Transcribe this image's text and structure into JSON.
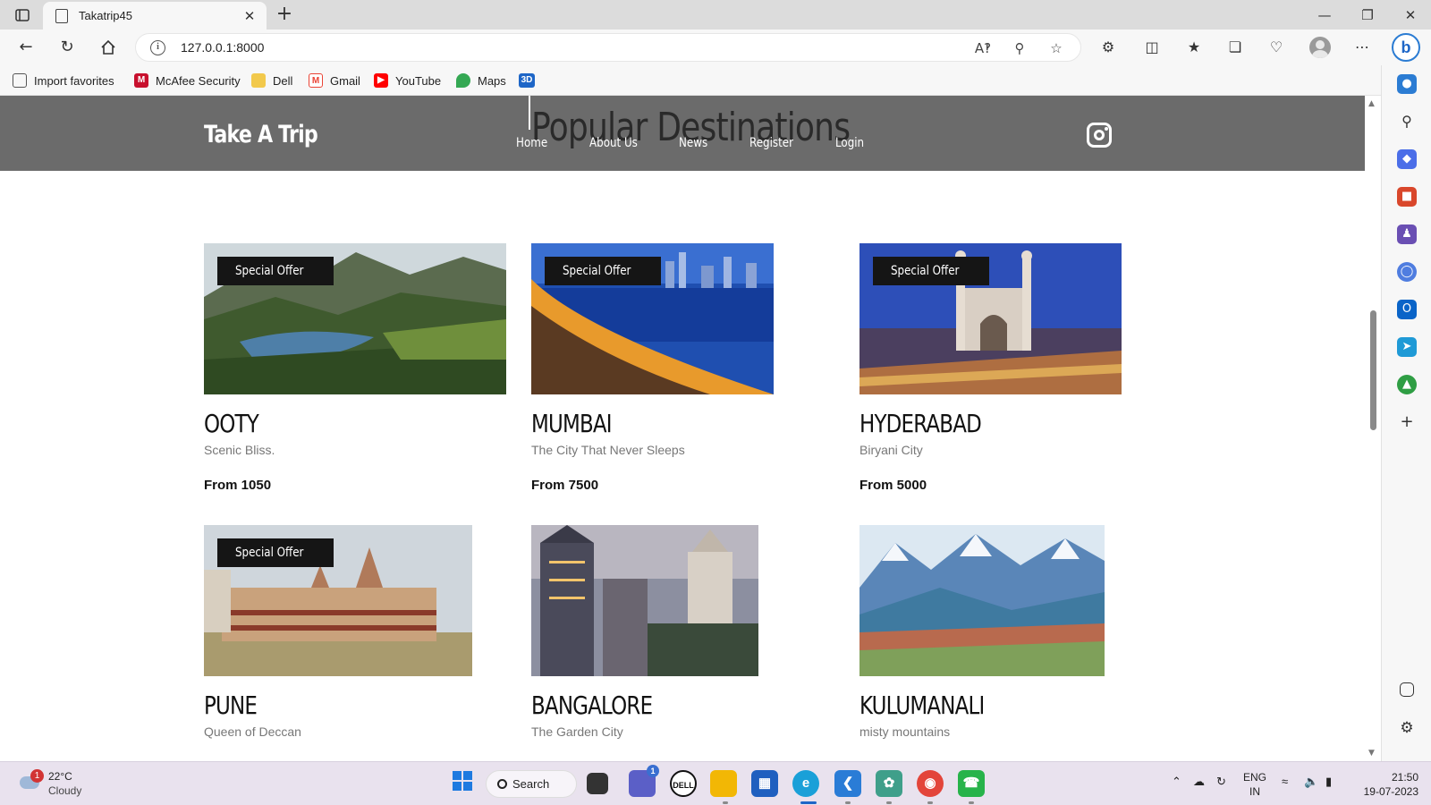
{
  "browser": {
    "tab_title": "Takatrip45",
    "tab_close": "✕",
    "new_tab": "+",
    "url": "127.0.0.1:8000",
    "window_controls": {
      "minimize": "—",
      "restore": "❐",
      "close": "✕"
    },
    "favorites": [
      {
        "label": "Import favorites",
        "icon": "import-icon",
        "color": "#555555"
      },
      {
        "label": "McAfee Security",
        "icon": "mcafee-icon",
        "color": "#c8102e"
      },
      {
        "label": "Dell",
        "icon": "folder-icon",
        "color": "#f2c94c"
      },
      {
        "label": "Gmail",
        "icon": "gmail-icon",
        "color": "#ea4335"
      },
      {
        "label": "YouTube",
        "icon": "youtube-icon",
        "color": "#ff0000"
      },
      {
        "label": "Maps",
        "icon": "maps-icon",
        "color": "#34a853"
      },
      {
        "label": "",
        "icon": "3d-icon",
        "color": "#1e66c7"
      }
    ]
  },
  "site": {
    "brand": "Take A Trip",
    "overlay_heading": "Popular Destinations",
    "nav": [
      "Home",
      "About Us",
      "News",
      "Register",
      "Login"
    ],
    "social_icon": "instagram-icon"
  },
  "destinations": [
    {
      "name": "OOTY",
      "tagline": "Scenic Bliss.",
      "price": "From 1050",
      "badge": "Special Offer"
    },
    {
      "name": "MUMBAI",
      "tagline": "The City That Never Sleeps",
      "price": "From 7500",
      "badge": "Special Offer"
    },
    {
      "name": "HYDERABAD",
      "tagline": "Biryani City",
      "price": "From 5000",
      "badge": "Special Offer"
    },
    {
      "name": "PUNE",
      "tagline": "Queen of Deccan",
      "badge": "Special Offer"
    },
    {
      "name": "BANGALORE",
      "tagline": "The Garden City"
    },
    {
      "name": "KULUMANALI",
      "tagline": "misty mountains"
    }
  ],
  "taskbar": {
    "weather_alert_count": "1",
    "temperature": "22°C",
    "condition": "Cloudy",
    "search_label": "Search",
    "teams_badge": "1",
    "lang_line1": "ENG",
    "lang_line2": "IN",
    "time": "21:50",
    "date": "19-07-2023"
  },
  "colors": {
    "header_bg": "#6b6b6b",
    "badge_bg": "#151515",
    "accent": "#1e66c7"
  }
}
